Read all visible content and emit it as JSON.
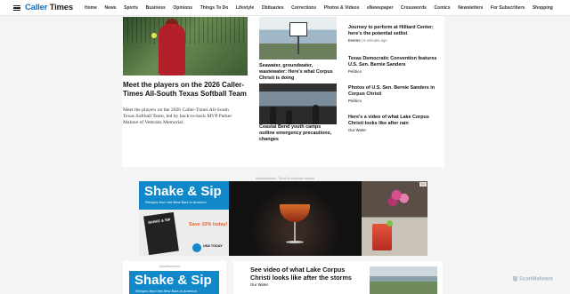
{
  "header": {
    "logo_accent": "Caller",
    "logo_rest": " Times",
    "nav": [
      "Home",
      "News",
      "Sports",
      "Business",
      "Opinions",
      "Things To Do",
      "Lifestyle",
      "Obituaries",
      "Corrections",
      "Photos & Videos",
      "eNewspaper",
      "Crosswords",
      "Comics",
      "Newsletters",
      "For Subscribers",
      "Shopping"
    ]
  },
  "lead": {
    "title": "Meet the players on the 2026 Caller-Times All-South Texas Softball Team",
    "description": "Meet the players on the 2026 Caller-Times All-South Texas Softball Team, led by back-to-back MVP Parker Malone of Veterans Memorial."
  },
  "middle": {
    "story1": "Seawater, groundwater, wastewater: Here's what Corpus Christi is doing",
    "story2": "Coastal Bend youth camps outline emergency precautions, changes"
  },
  "right": [
    {
      "title": "Journey to perform at Hilliard Center; here's the potential setlist",
      "section": "Events",
      "time": "| 6 minutes ago"
    },
    {
      "title": "Texas Democratic Convention features U.S. Sen. Bernie Sanders",
      "section": "Politics",
      "time": ""
    },
    {
      "title": "Photos of U.S. Sen. Bernie Sanders in Corpus Christi",
      "section": "Politics",
      "time": ""
    },
    {
      "title": "Here's a video of what Lake Corpus Christi looks like after rain",
      "section": "Our Water",
      "time": ""
    }
  ],
  "ad": {
    "label": "Advertisement - Scroll to continue content",
    "brand": "Shake & Sip",
    "subtitle": "Recipes from the Best Bars in America",
    "book_title": "SHAKE & SIP",
    "save": "Save 10% today!",
    "usa": "USA TODAY",
    "adchoices": "i ▷"
  },
  "second_ad": {
    "label": "Advertisement",
    "brand": "Shake & Sip",
    "subtitle": "Recipes from the Best Bars in America"
  },
  "bottom_card": {
    "title": "See video of what Lake Corpus Christi looks like after the storms",
    "section": "Our Water"
  },
  "watermark": "ScanMalware",
  "colors": {
    "accent": "#0a6fc2",
    "ad_blue": "#1188c9",
    "ad_orange": "#e8632e"
  }
}
